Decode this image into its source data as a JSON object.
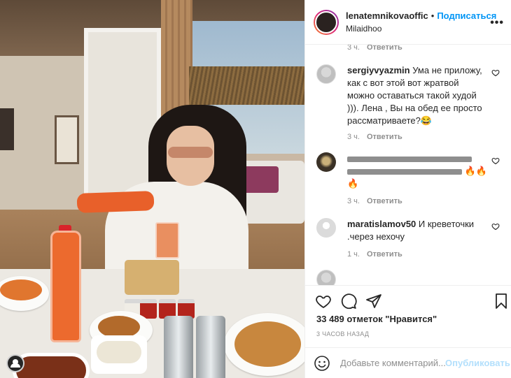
{
  "header": {
    "username": "lenatemnikovaoffic",
    "dot": "•",
    "follow_label": "Подписаться",
    "location": "Milaidhoo",
    "more_label": "•••"
  },
  "comments": {
    "top_meta": {
      "time": "3 ч.",
      "reply": "Ответить"
    },
    "items": [
      {
        "username": "sergiyvyazmin",
        "text": "Ума не приложу, как с вот этой вот жратвой можно оставаться такой худой ))). Лена , Вы на обед ее просто рассматриваете?😂",
        "time": "3 ч.",
        "reply": "Ответить"
      },
      {
        "username": "",
        "text": "🔥🔥🔥",
        "time": "3 ч.",
        "reply": "Ответить"
      },
      {
        "username": "maratislamov50",
        "text": "И креветочки .через нехочу",
        "time": "1 ч.",
        "reply": "Ответить"
      }
    ]
  },
  "actions": {
    "likes": "33 489 отметок \"Нравится\"",
    "timestamp": "3 ЧАСОВ НАЗАД"
  },
  "composer": {
    "placeholder": "Добавьте комментарий...",
    "post_label": "Опубликовать"
  },
  "colors": {
    "accent": "#0095f6",
    "post_disabled": "#b2dffc",
    "secondary_text": "#8e8e8e"
  }
}
